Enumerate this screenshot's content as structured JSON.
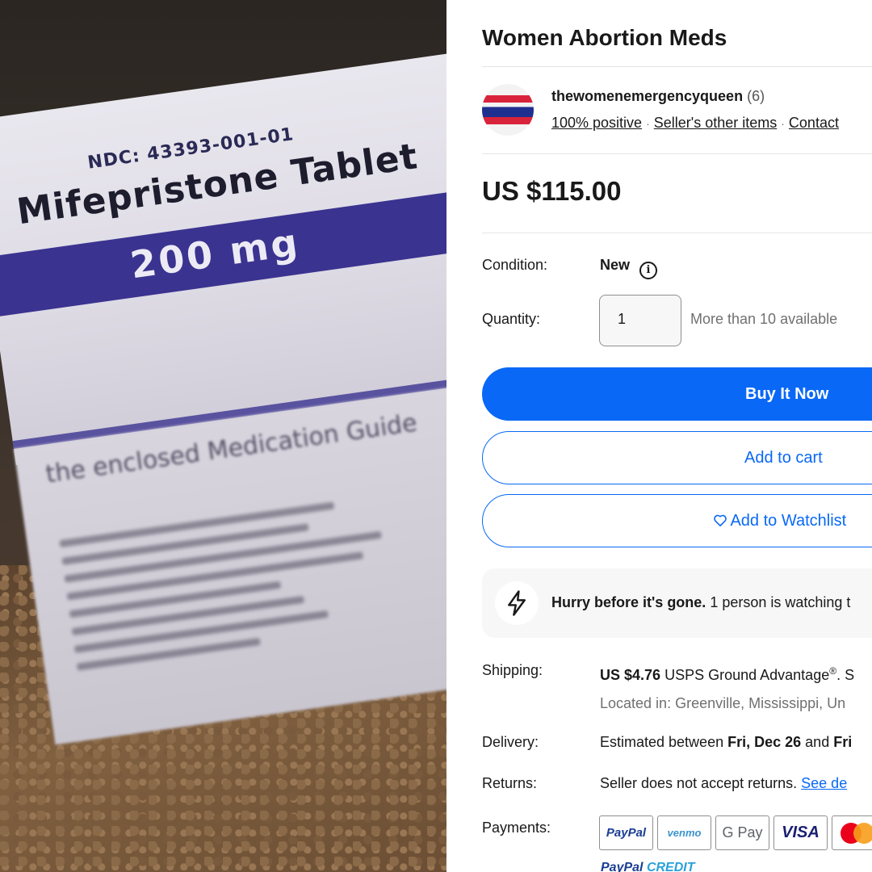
{
  "photo": {
    "ndc": "NDC: 43393-001-01",
    "drug_name": "Mifepristone Tablet",
    "dose": "200 mg",
    "guide_text": "the enclosed Medication Guide"
  },
  "listing": {
    "title": "Women Abortion Meds",
    "seller": {
      "name": "thewomenemergencyqueen",
      "feedback_count": "(6)",
      "positive": "100% positive",
      "other_items": "Seller's other items",
      "contact": "Contact"
    },
    "price": "US $115.00",
    "condition": {
      "label": "Condition:",
      "value": "New"
    },
    "quantity": {
      "label": "Quantity:",
      "value": "1",
      "available": "More than 10 available"
    },
    "buttons": {
      "buy_now": "Buy It Now",
      "add_to_cart": "Add to cart",
      "add_to_watchlist": "Add to Watchlist"
    },
    "hurry": {
      "bold": "Hurry before it's gone.",
      "text": "1 person is watching t"
    },
    "shipping": {
      "label": "Shipping:",
      "cost": "US $4.76",
      "service": "USPS Ground Advantage",
      "reg": "®",
      "trail": ". S",
      "location": "Located in: Greenville, Mississippi, Un"
    },
    "delivery": {
      "label": "Delivery:",
      "prefix": "Estimated between",
      "start": "Fri, Dec 26",
      "and": "and",
      "end": "Fri"
    },
    "returns": {
      "label": "Returns:",
      "text": "Seller does not accept returns.",
      "link": "See de"
    },
    "payments": {
      "label": "Payments:",
      "methods": [
        "PayPal",
        "venmo",
        "G Pay",
        "VISA"
      ],
      "credit_a": "PayPal",
      "credit_b": "CREDIT"
    }
  },
  "colors": {
    "accent": "#0968f6",
    "text": "#191919",
    "muted": "#707070"
  },
  "icons": [
    "info-icon",
    "heart-icon",
    "lightning-icon",
    "mastercard-icon"
  ]
}
